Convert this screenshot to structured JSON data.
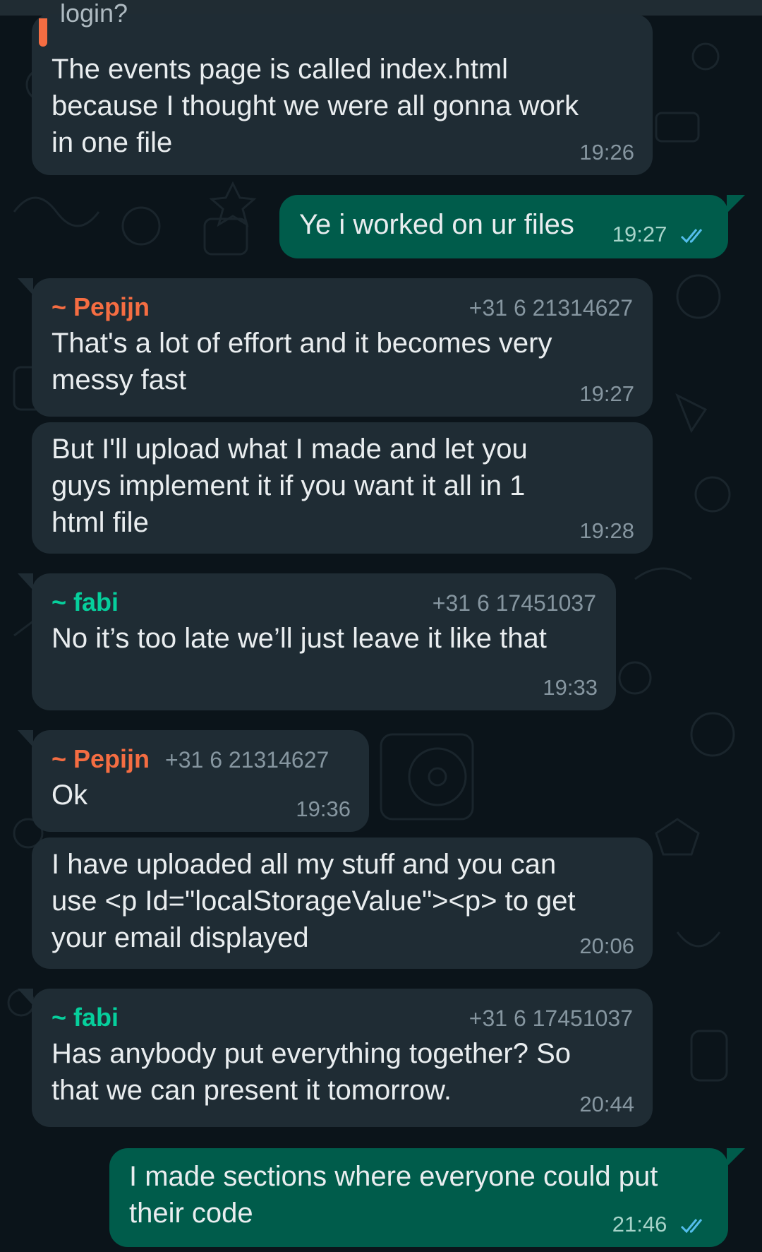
{
  "messages": [
    {
      "id": "m0",
      "partial_quote": "login?",
      "text": "The events page is called index.html\nbecause I thought we were all gonna work\nin one file",
      "time": "19:26"
    },
    {
      "id": "m1",
      "text": "Ye i worked on ur files",
      "time": "19:27",
      "outgoing": true
    },
    {
      "id": "m2",
      "sender": "~ Pepijn",
      "phone": "+31 6 21314627",
      "text": "That's a lot of effort and it becomes very\nmessy fast",
      "time": "19:27"
    },
    {
      "id": "m3",
      "text": "But I'll upload what I made and let you\nguys implement it if you want it all in 1\nhtml file",
      "time": "19:28"
    },
    {
      "id": "m4",
      "sender": "~ fabi",
      "phone": "+31 6 17451037",
      "text": "No it’s too late we’ll just leave it like that",
      "time": "19:33"
    },
    {
      "id": "m5",
      "sender": "~ Pepijn",
      "phone": "+31 6 21314627",
      "text": "Ok",
      "time": "19:36"
    },
    {
      "id": "m6",
      "text": "I have uploaded all my stuff and you can\nuse <p Id=\"localStorageValue\"><p> to get\nyour email displayed",
      "time": "20:06"
    },
    {
      "id": "m7",
      "sender": "~ fabi",
      "phone": "+31 6 17451037",
      "text": "Has anybody put everything together? So\nthat we can present it tomorrow.",
      "time": "20:44"
    },
    {
      "id": "m8",
      "text": "I made sections where everyone could put\ntheir code",
      "time": "21:46",
      "outgoing": true
    }
  ],
  "colors": {
    "background": "#0b141a",
    "incoming_bubble": "#1f2c34",
    "outgoing_bubble": "#005c4b",
    "pepijn_name": "#f56d42",
    "fabi_name": "#06cf9c",
    "read_ticks": "#53bdeb"
  }
}
